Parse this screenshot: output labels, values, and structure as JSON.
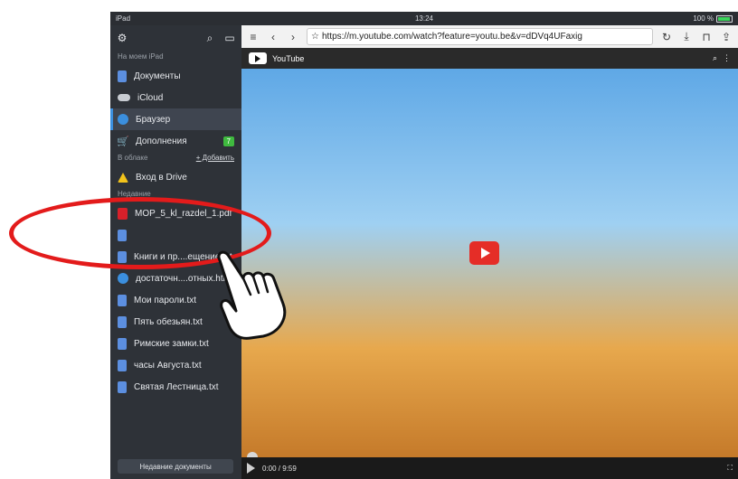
{
  "status": {
    "device": "iPad",
    "time": "13:24",
    "battery": "100 %"
  },
  "sidebar": {
    "section_device": "На моем iPad",
    "items_device": [
      {
        "icon": "document-icon",
        "label": "Документы"
      },
      {
        "icon": "cloud-icon",
        "label": "iCloud"
      },
      {
        "icon": "compass-icon",
        "label": "Браузер",
        "active": true
      },
      {
        "icon": "cart-icon",
        "label": "Дополнения",
        "badge": "7"
      }
    ],
    "section_cloud": "В облаке",
    "add_link": "+ Добавить",
    "drive_item": "Вход в Drive",
    "section_recent": "Недавние",
    "recent": [
      {
        "icon": "pdf-icon",
        "label": "MOP_5_kl_razdel_1.pdf"
      },
      {
        "icon": "document-icon",
        "label": ""
      },
      {
        "icon": "document-icon",
        "label": "Книги и пр....ещение.txt"
      },
      {
        "icon": "globe-icon",
        "label": "достаточн....отных.html"
      },
      {
        "icon": "document-icon",
        "label": "Мои пароли.txt"
      },
      {
        "icon": "document-icon",
        "label": "Пять обезьян.txt"
      },
      {
        "icon": "document-icon",
        "label": "Римские замки.txt"
      },
      {
        "icon": "document-icon",
        "label": "часы Августа.txt"
      },
      {
        "icon": "document-icon",
        "label": "Святая Лестница.txt"
      }
    ],
    "recent_button": "Недавние документы"
  },
  "browser": {
    "url": "https://m.youtube.com/watch?feature=youtu.be&v=dDVq4UFaxig",
    "site_title": "YouTube",
    "time_display": "0:00 / 9:59"
  },
  "colors": {
    "highlight": "#e31b1b",
    "accent": "#3b8fde",
    "youtube_red": "#e52d27"
  }
}
